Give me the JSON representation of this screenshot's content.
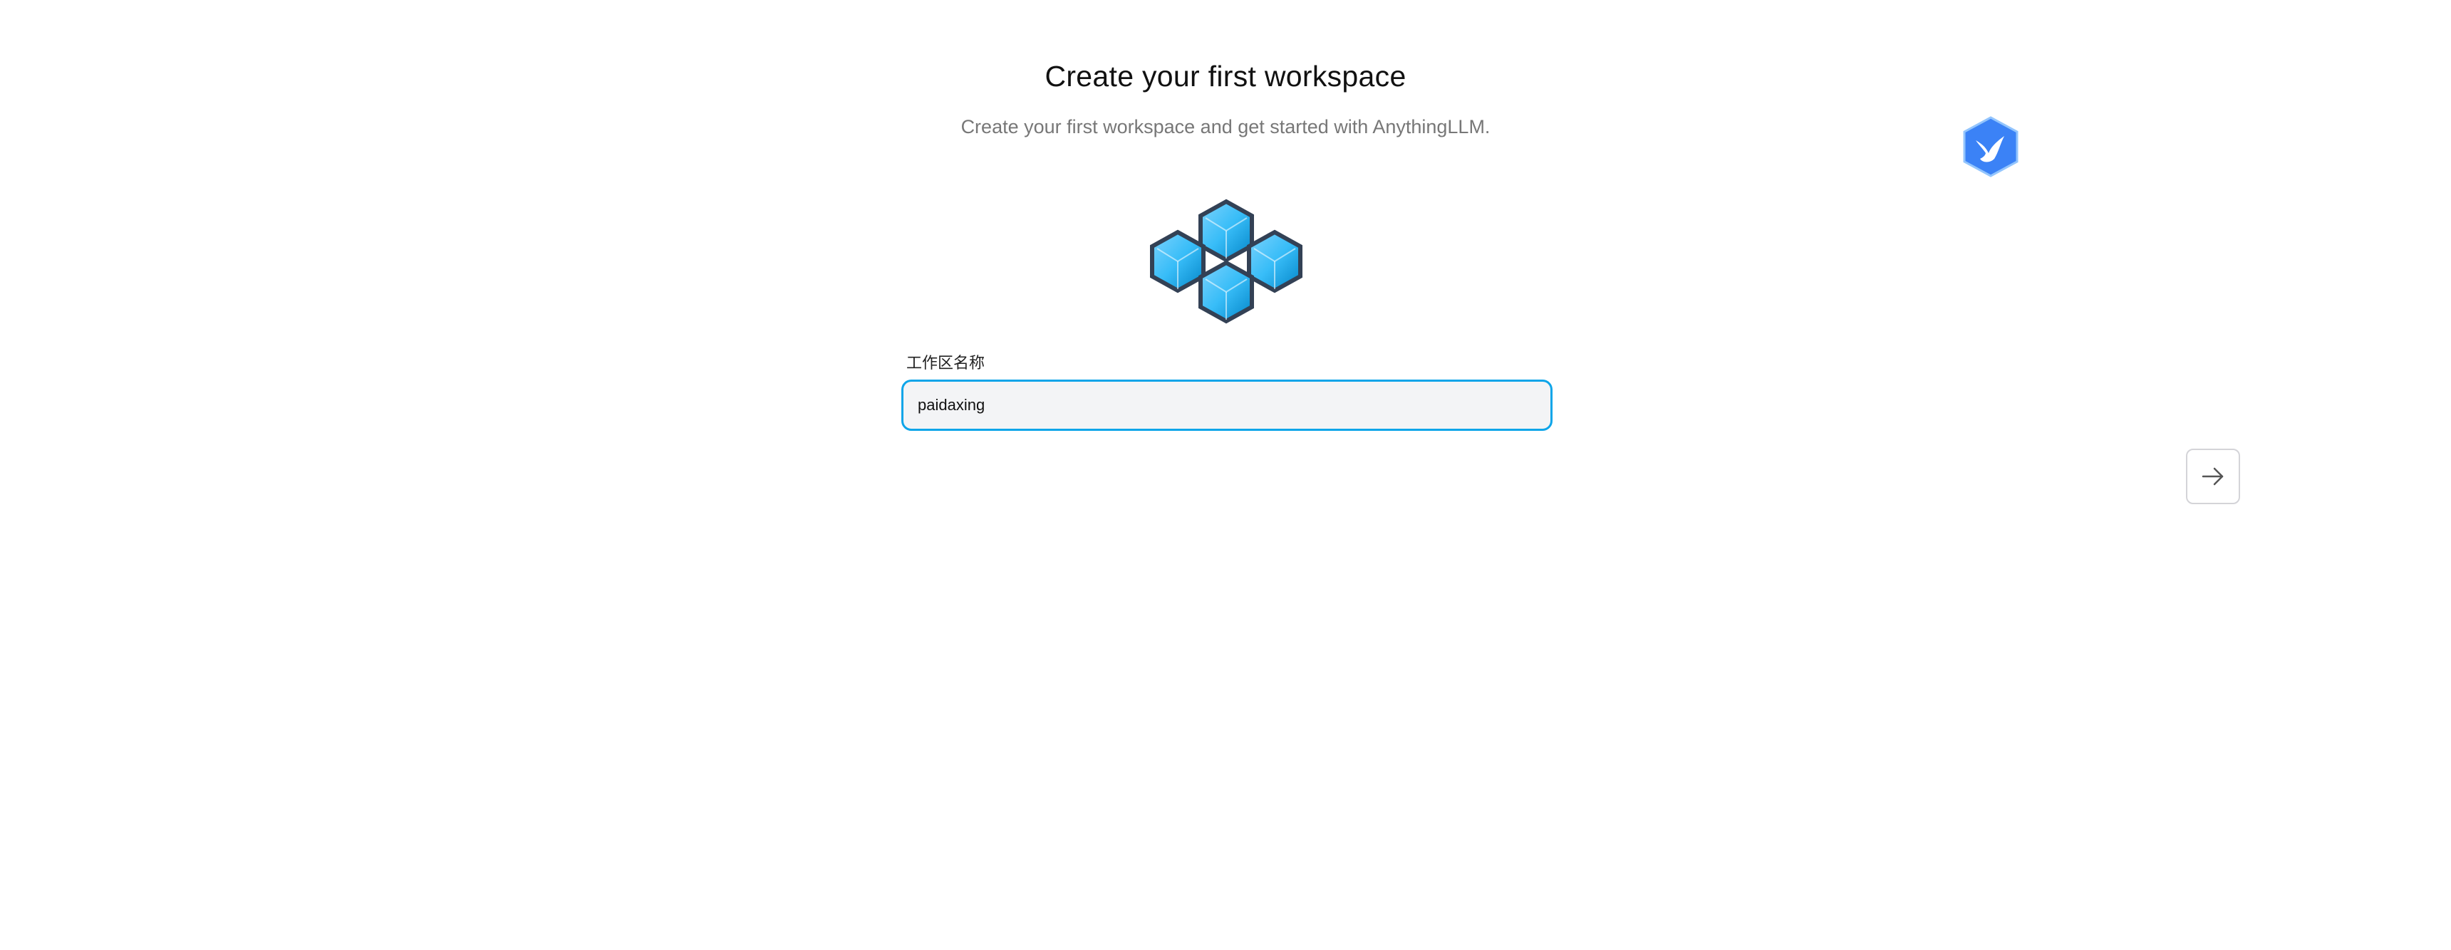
{
  "header": {
    "title": "Create your first workspace",
    "subtitle": "Create your first workspace and get started with AnythingLLM."
  },
  "illustration": {
    "icon": "workspace-hexagons-icon",
    "colors": {
      "fill": "#38bdf8",
      "stroke": "#334155"
    }
  },
  "form": {
    "workspace_name_label": "工作区名称",
    "workspace_name_value": "paidaxing"
  },
  "badge": {
    "icon": "bird-badge-icon",
    "color": "#3b82f6"
  },
  "navigation": {
    "next_icon": "arrow-right-icon"
  },
  "colors": {
    "accent": "#0ea5e9",
    "input_background": "#f3f4f6"
  }
}
